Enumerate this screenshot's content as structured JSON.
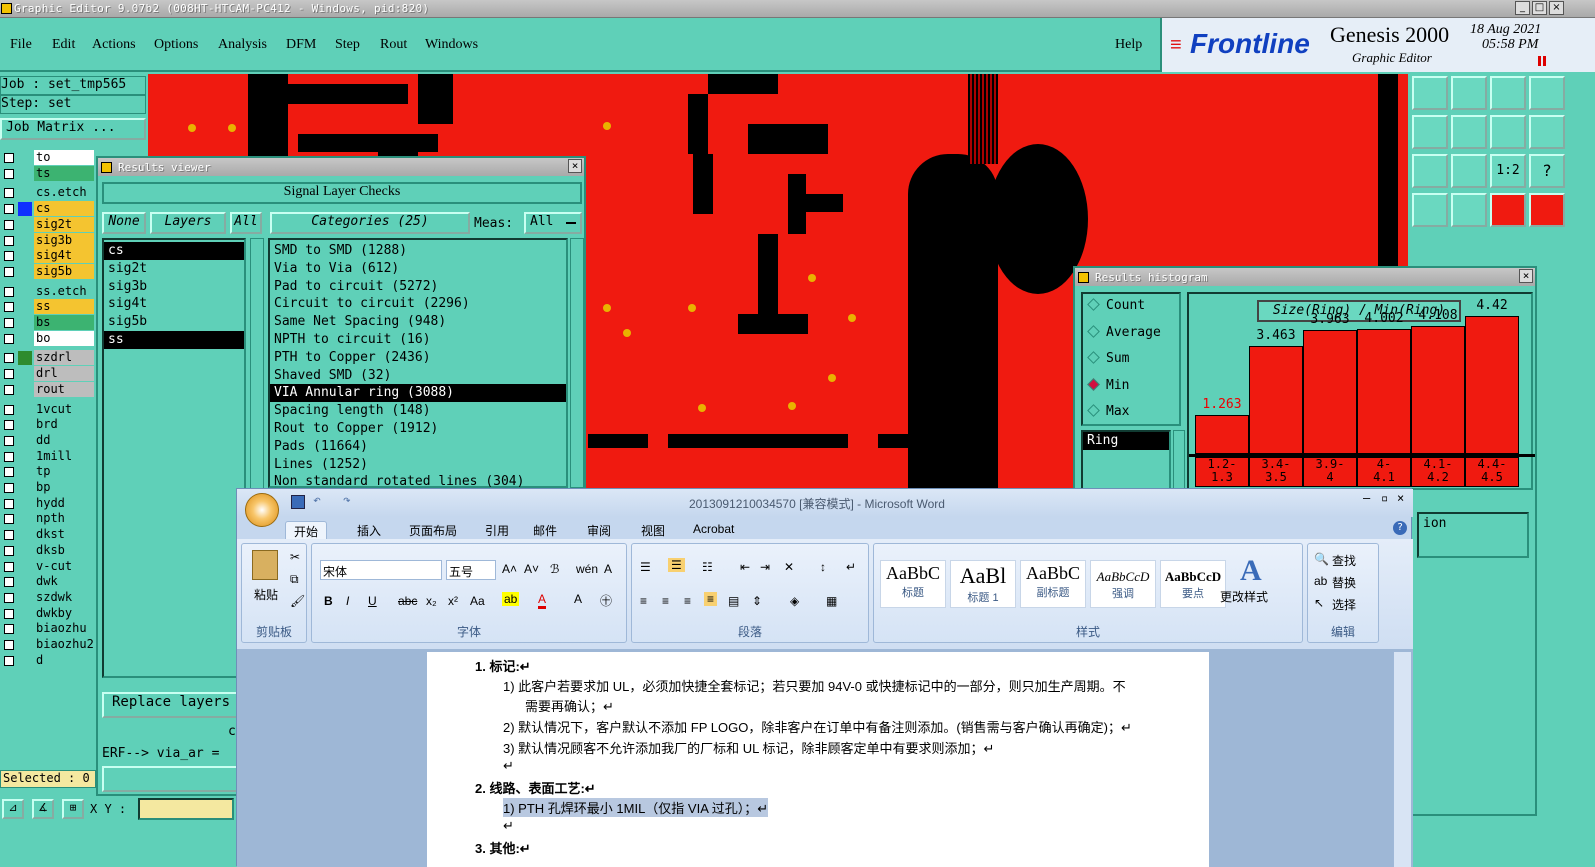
{
  "app": {
    "title": "Graphic Editor 9.07b2 (008HT-HTCAM-PC412 - Windows, pid:820)",
    "menu": [
      "File",
      "Edit",
      "Actions",
      "Options",
      "Analysis",
      "DFM",
      "Step",
      "Rout",
      "Windows"
    ],
    "help": "Help",
    "brand": {
      "logo": "Frontline",
      "product": "Genesis 2000",
      "subtitle": "Graphic Editor",
      "date": "18 Aug 2021",
      "time": "05:58 PM"
    }
  },
  "left_panel": {
    "job": "Job : set_tmp565",
    "step": "Step: set",
    "job_matrix": "Job Matrix ...",
    "layers": [
      {
        "name": "to",
        "color": "#ffffff"
      },
      {
        "name": "ts",
        "color": "#3cb371"
      },
      {
        "name": "cs.etch",
        "color": "#5fd0b8"
      },
      {
        "name": "cs",
        "color": "#f4c430",
        "swatch": "#1030ff"
      },
      {
        "name": "sig2t",
        "color": "#f4c430"
      },
      {
        "name": "sig3b",
        "color": "#f4c430"
      },
      {
        "name": "sig4t",
        "color": "#f4c430"
      },
      {
        "name": "sig5b",
        "color": "#f4c430"
      },
      {
        "name": "ss.etch",
        "color": "#5fd0b8"
      },
      {
        "name": "ss",
        "color": "#f4c430"
      },
      {
        "name": "bs",
        "color": "#3cb371"
      },
      {
        "name": "bo",
        "color": "#ffffff"
      },
      {
        "name": "szdrl",
        "color": "#bdbdbd",
        "swatch": "#2e8b2e"
      },
      {
        "name": "drl",
        "color": "#bdbdbd"
      },
      {
        "name": "rout",
        "color": "#bdbdbd"
      },
      {
        "name": "1vcut",
        "color": "#5fd0b8"
      },
      {
        "name": "brd",
        "color": "#5fd0b8"
      },
      {
        "name": "dd",
        "color": "#5fd0b8"
      },
      {
        "name": "1mill",
        "color": "#5fd0b8"
      },
      {
        "name": "tp",
        "color": "#5fd0b8"
      },
      {
        "name": "bp",
        "color": "#5fd0b8"
      },
      {
        "name": "hydd",
        "color": "#5fd0b8"
      },
      {
        "name": "npth",
        "color": "#5fd0b8"
      },
      {
        "name": "dkst",
        "color": "#5fd0b8"
      },
      {
        "name": "dksb",
        "color": "#5fd0b8"
      },
      {
        "name": "v-cut",
        "color": "#5fd0b8"
      },
      {
        "name": "dwk",
        "color": "#5fd0b8"
      },
      {
        "name": "szdwk",
        "color": "#5fd0b8"
      },
      {
        "name": "dwkby",
        "color": "#5fd0b8"
      },
      {
        "name": "biaozhu",
        "color": "#5fd0b8"
      },
      {
        "name": "biaozhu2",
        "color": "#5fd0b8"
      },
      {
        "name": "d",
        "color": "#5fd0b8"
      }
    ],
    "selected": "Selected : 0",
    "xy_label": "X Y :"
  },
  "results_viewer": {
    "title": "Results viewer",
    "heading": "Signal Layer Checks",
    "none_btn": "None",
    "layers_btn": "Layers",
    "all_btn": "All",
    "categories_btn": "Categories (25)",
    "meas_label": "Meas:",
    "meas_value": "All",
    "layer_list": [
      "cs",
      "sig2t",
      "sig3b",
      "sig4t",
      "sig5b",
      "ss"
    ],
    "categories": [
      "SMD to SMD (1288)",
      "Via to Via (612)",
      "Pad to circuit (5272)",
      "Circuit to circuit (2296)",
      "Same Net Spacing (948)",
      "NPTH to circuit (16)",
      "PTH to Copper (2436)",
      "Shaved SMD (32)",
      "VIA Annular ring (3088)",
      "Spacing length (148)",
      "Rout to Copper (1912)",
      "Pads (11664)",
      "Lines (1252)",
      "Non standard rotated lines (304)"
    ],
    "replace_btn": "Replace layers",
    "erf_text": "ERF--> via_ar =",
    "close_btn": "Cl",
    "c_label": "c"
  },
  "histogram": {
    "title": "Results histogram",
    "options": [
      "Count",
      "Average",
      "Sum",
      "Min",
      "Max"
    ],
    "selected_option": "Min",
    "list_item": "Ring",
    "chart_title": "Size(Ring) / Min(Ring)",
    "partial_text": "ion"
  },
  "chart_data": {
    "type": "bar",
    "title": "Size(Ring) / Min(Ring)",
    "categories": [
      "1.2-1.3",
      "3.4-3.5",
      "3.9-4",
      "4-4.1",
      "4.1-4.2",
      "4.4-4.5"
    ],
    "values": [
      1.263,
      3.463,
      3.963,
      4.002,
      4.108,
      4.42
    ],
    "labels": [
      "1.2-\n1.3",
      "3.4-\n3.5",
      "3.9-\n4",
      "4-\n4.1",
      "4.1-\n4.2",
      "4.4-\n4.5"
    ],
    "ylim": [
      0,
      5
    ]
  },
  "word": {
    "title": "2013091210034570 [兼容模式] - Microsoft Word",
    "tabs": [
      "开始",
      "插入",
      "页面布局",
      "引用",
      "邮件",
      "审阅",
      "视图",
      "Acrobat"
    ],
    "paste_label": "粘贴",
    "clipboard_label": "剪贴板",
    "font_name": "宋体",
    "font_size": "五号",
    "font_group": "字体",
    "paragraph_group": "段落",
    "styles_group": "样式",
    "edit_group": "编辑",
    "styles": [
      {
        "preview": "AaBbC",
        "name": "标题"
      },
      {
        "preview": "AaBl",
        "name": "标题 1"
      },
      {
        "preview": "AaBbC",
        "name": "副标题"
      },
      {
        "preview": "AaBbCcD",
        "name": "强调"
      },
      {
        "preview": "AaBbCcD",
        "name": "要点"
      }
    ],
    "change_styles": "更改样式",
    "find": "查找",
    "replace": "替换",
    "select": "选择",
    "doc_lines": [
      "1.   标记:↵",
      "1)   此客户若要求加 UL，必须加快捷全套标记；若只要加 94V-0 或快捷标记中的一部分，则只加生产周期。不",
      "需要再确认；↵",
      "2)   默认情况下，客户默认不添加 FP LOGO，除非客户在订单中有备注则添加。(销售需与客户确认再确定)；↵",
      "3)   默认情况顾客不允许添加我厂的厂标和 UL 标记，除非顾客定单中有要求则添加；↵",
      "↵",
      "2.   线路、表面工艺:↵",
      "1)   PTH 孔焊环最小 1MIL（仅指 VIA 过孔）；↵",
      "↵",
      "3.   其他:↵"
    ]
  }
}
